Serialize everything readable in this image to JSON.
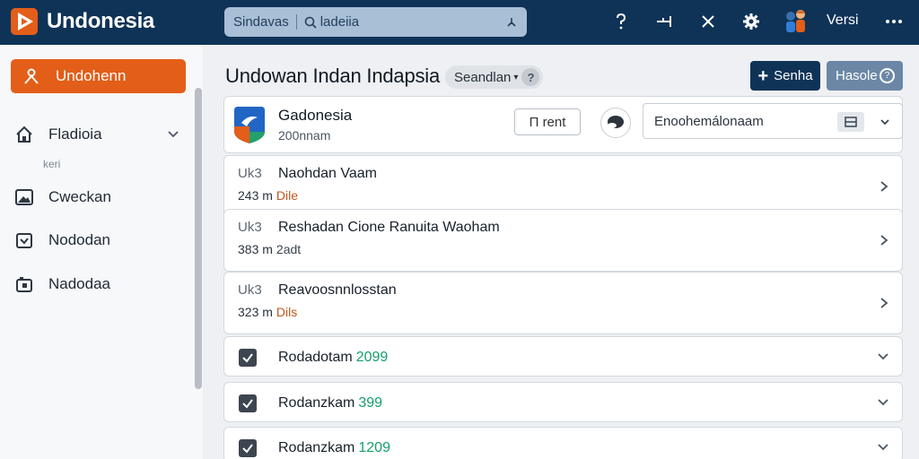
{
  "app": {
    "title": "Undonesia",
    "brand_color": "#e35e19",
    "nav_color": "#0f3357"
  },
  "search": {
    "scope": "Sindavas",
    "value": "ladeiia",
    "icon": "search-icon"
  },
  "toolbar": {
    "help_icon": "help-icon",
    "pin_icon": "pin-icon",
    "close_icon": "close-icon",
    "settings_icon": "gear-icon",
    "users_icon": "users-icon",
    "user_label": "Versi",
    "more_icon": "more-icon"
  },
  "sidebar": {
    "primary_label": "Undohenn",
    "items": [
      {
        "label": "Fladioia",
        "icon": "home-icon"
      },
      {
        "label": "Cweckan",
        "icon": "image-icon"
      },
      {
        "label": "Nododan",
        "icon": "badge-icon"
      },
      {
        "label": "Nadodaa",
        "icon": "camera-icon"
      }
    ],
    "sub_label": "keri"
  },
  "main": {
    "title": "Undowan Indan Indapsia",
    "chip_label": "Seandlan",
    "chip_help": "?",
    "new_button": "Senha",
    "secondary_button": "Hasole",
    "secondary_icon": "?"
  },
  "header_card": {
    "name": "Gadonesia",
    "meta": "200nnam",
    "filter_label": "Π rent",
    "select_value": "Enoohemálonaam"
  },
  "rows": [
    {
      "code": "Uk3",
      "title": "Naohdan Vaam",
      "size": "243 m",
      "tag": "Dile",
      "tag_style": "orange"
    },
    {
      "code": "Uk3",
      "title": "Reshadan Cione Ranuita Waoham",
      "size": "383 m",
      "tag": "2adt",
      "tag_style": "dark"
    },
    {
      "code": "Uk3",
      "title": "Reavoosnnlosstan",
      "size": "323 m",
      "tag": "Dils",
      "tag_style": "orange"
    }
  ],
  "check_rows": [
    {
      "label": "Rodadotam",
      "number": "2099",
      "checked": true
    },
    {
      "label": "Rodanzkam",
      "number": "399",
      "checked": true
    },
    {
      "label": "Rodanzkam",
      "number": "1209",
      "checked": true
    }
  ]
}
